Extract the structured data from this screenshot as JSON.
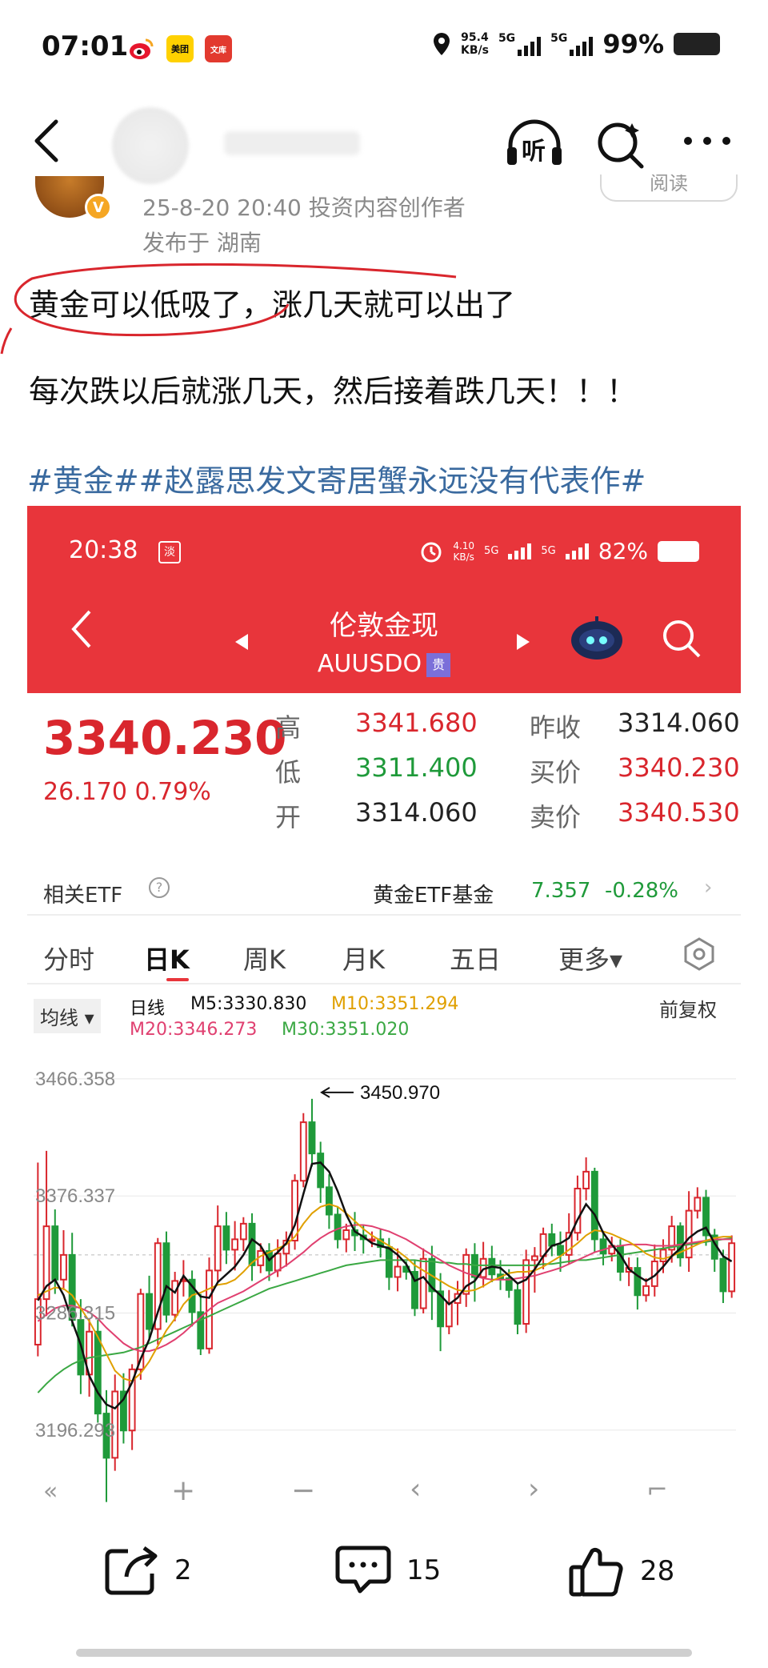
{
  "status_bar": {
    "time": "07:01",
    "app_icons": [
      "weibo",
      "美团",
      "文库"
    ],
    "net_speed_value": "95.4",
    "net_speed_unit": "KB/s",
    "net_1": "5G",
    "net_2": "5G",
    "battery": "99%"
  },
  "header": {
    "back": "back-arrow",
    "listen_label": "听",
    "search": "search-icon",
    "more": "more-icon"
  },
  "post": {
    "meta_line1": "25-8-20 20:40  投资内容创作者",
    "meta_line2": "发布于 湖南",
    "follow_label": "阅读",
    "line1": "黄金可以低吸了，涨几天就可以出了",
    "line2": "每次跌以后就涨几天，然后接着跌几天！！！",
    "hashtags": "#黄金##赵露思发文寄居蟹永远没有代表作#"
  },
  "embed": {
    "status": {
      "time": "20:38",
      "badge": "淡",
      "speed_value": "4.10",
      "speed_unit": "KB/s",
      "net_1": "5G",
      "net_2": "5G",
      "battery": "82%"
    },
    "title": "伦敦金现",
    "code": "AUUSDO",
    "code_tag": "贵",
    "price": "3340.230",
    "change": "26.170  0.79%",
    "quote_rows": [
      {
        "l1": "高",
        "v1": "3341.680",
        "l2": "昨收",
        "v2": "3314.060"
      },
      {
        "l1": "低",
        "v1": "3311.400",
        "l2": "买价",
        "v2": "3340.230"
      },
      {
        "l1": "开",
        "v1": "3314.060",
        "l2": "卖价",
        "v2": "3340.530"
      }
    ],
    "etf_label": "相关ETF",
    "etf_name": "黄金ETF基金",
    "etf_value": "7.357",
    "etf_change": "-0.28%",
    "tabs": [
      "分时",
      "日K",
      "周K",
      "月K",
      "五日",
      "更多▾"
    ],
    "ma_selector": "均线",
    "ma_daily": "日线",
    "ma5": "M5:3330.830",
    "ma10": "M10:3351.294",
    "ma20": "M20:3346.273",
    "ma30": "M30:3351.020",
    "adjust": "前复权",
    "colors": {
      "up": "#d9262d",
      "down": "#1f9a3a",
      "ma5": "#111111",
      "ma10": "#e0a000",
      "ma20": "#e04070",
      "ma30": "#3aa843"
    }
  },
  "chart_data": {
    "type": "candlestick",
    "title": "",
    "y_ticks": [
      "3466.358",
      "3376.337",
      "3286.315",
      "3196.293"
    ],
    "annotation": "3450.970",
    "ylim": [
      3150,
      3470
    ],
    "candles": [
      [
        3262,
        3297,
        3253,
        3402
      ],
      [
        3297,
        3353,
        3284,
        3411
      ],
      [
        3353,
        3312,
        3301,
        3366
      ],
      [
        3312,
        3331,
        3304,
        3350
      ],
      [
        3331,
        3281,
        3276,
        3348
      ],
      [
        3281,
        3239,
        3224,
        3297
      ],
      [
        3239,
        3272,
        3222,
        3282
      ],
      [
        3272,
        3209,
        3202,
        3281
      ],
      [
        3209,
        3175,
        3141,
        3227
      ],
      [
        3175,
        3226,
        3165,
        3239
      ],
      [
        3226,
        3196,
        3186,
        3240
      ],
      [
        3196,
        3243,
        3181,
        3247
      ],
      [
        3243,
        3301,
        3235,
        3305
      ],
      [
        3301,
        3274,
        3266,
        3315
      ],
      [
        3274,
        3340,
        3262,
        3344
      ],
      [
        3340,
        3285,
        3279,
        3349
      ],
      [
        3285,
        3311,
        3280,
        3318
      ],
      [
        3311,
        3312,
        3299,
        3327
      ],
      [
        3312,
        3287,
        3276,
        3319
      ],
      [
        3287,
        3259,
        3254,
        3301
      ],
      [
        3259,
        3319,
        3255,
        3329
      ],
      [
        3319,
        3353,
        3310,
        3369
      ],
      [
        3353,
        3335,
        3324,
        3364
      ],
      [
        3335,
        3343,
        3319,
        3357
      ],
      [
        3343,
        3355,
        3334,
        3360
      ],
      [
        3355,
        3323,
        3311,
        3363
      ],
      [
        3323,
        3334,
        3317,
        3340
      ],
      [
        3334,
        3319,
        3311,
        3340
      ],
      [
        3319,
        3332,
        3314,
        3343
      ],
      [
        3332,
        3342,
        3322,
        3349
      ],
      [
        3342,
        3388,
        3335,
        3393
      ],
      [
        3388,
        3433,
        3383,
        3440
      ],
      [
        3433,
        3409,
        3399,
        3451
      ],
      [
        3409,
        3383,
        3371,
        3418
      ],
      [
        3383,
        3362,
        3351,
        3393
      ],
      [
        3362,
        3343,
        3336,
        3368
      ],
      [
        3343,
        3350,
        3333,
        3355
      ],
      [
        3350,
        3346,
        3334,
        3364
      ],
      [
        3346,
        3343,
        3332,
        3354
      ],
      [
        3343,
        3343,
        3337,
        3349
      ],
      [
        3343,
        3337,
        3329,
        3351
      ],
      [
        3337,
        3314,
        3304,
        3344
      ],
      [
        3314,
        3322,
        3303,
        3336
      ],
      [
        3322,
        3318,
        3312,
        3326
      ],
      [
        3318,
        3290,
        3284,
        3327
      ],
      [
        3290,
        3328,
        3286,
        3336
      ],
      [
        3328,
        3303,
        3281,
        3338
      ],
      [
        3303,
        3276,
        3257,
        3317
      ],
      [
        3276,
        3294,
        3270,
        3304
      ],
      [
        3294,
        3301,
        3277,
        3311
      ],
      [
        3301,
        3331,
        3291,
        3336
      ],
      [
        3331,
        3314,
        3295,
        3340
      ],
      [
        3314,
        3328,
        3306,
        3341
      ],
      [
        3328,
        3316,
        3310,
        3338
      ],
      [
        3316,
        3313,
        3304,
        3327
      ],
      [
        3313,
        3304,
        3298,
        3320
      ],
      [
        3304,
        3278,
        3270,
        3310
      ],
      [
        3278,
        3327,
        3271,
        3335
      ],
      [
        3327,
        3330,
        3302,
        3337
      ],
      [
        3330,
        3347,
        3320,
        3352
      ],
      [
        3347,
        3338,
        3330,
        3355
      ],
      [
        3338,
        3331,
        3318,
        3349
      ],
      [
        3331,
        3348,
        3324,
        3363
      ],
      [
        3348,
        3382,
        3342,
        3392
      ],
      [
        3382,
        3395,
        3373,
        3406
      ],
      [
        3395,
        3343,
        3333,
        3398
      ],
      [
        3343,
        3332,
        3323,
        3349
      ],
      [
        3332,
        3338,
        3326,
        3345
      ],
      [
        3338,
        3318,
        3311,
        3343
      ],
      [
        3318,
        3321,
        3307,
        3329
      ],
      [
        3321,
        3300,
        3289,
        3329
      ],
      [
        3300,
        3307,
        3295,
        3313
      ],
      [
        3307,
        3326,
        3299,
        3339
      ],
      [
        3326,
        3335,
        3317,
        3343
      ],
      [
        3335,
        3353,
        3325,
        3361
      ],
      [
        3353,
        3329,
        3322,
        3356
      ],
      [
        3329,
        3365,
        3318,
        3380
      ],
      [
        3365,
        3375,
        3359,
        3383
      ],
      [
        3375,
        3346,
        3338,
        3381
      ],
      [
        3346,
        3328,
        3318,
        3351
      ],
      [
        3328,
        3303,
        3294,
        3335
      ],
      [
        3303,
        3340,
        3298,
        3346
      ]
    ],
    "ma5": [
      3296,
      3307,
      3312,
      3300,
      3280,
      3262,
      3238,
      3225,
      3216,
      3213,
      3220,
      3233,
      3251,
      3266,
      3287,
      3307,
      3302,
      3315,
      3307,
      3299,
      3298,
      3310,
      3316,
      3322,
      3331,
      3343,
      3338,
      3327,
      3333,
      3340,
      3354,
      3378,
      3401,
      3402,
      3395,
      3380,
      3362,
      3349,
      3345,
      3340,
      3338,
      3336,
      3331,
      3324,
      3311,
      3314,
      3306,
      3300,
      3293,
      3298,
      3307,
      3311,
      3320,
      3322,
      3321,
      3315,
      3309,
      3312,
      3320,
      3330,
      3338,
      3340,
      3344,
      3358,
      3370,
      3362,
      3348,
      3339,
      3331,
      3320,
      3315,
      3311,
      3315,
      3322,
      3330,
      3336,
      3344,
      3349,
      3352,
      3340,
      3330,
      3326
    ],
    "ma10": [
      3300,
      3303,
      3306,
      3305,
      3300,
      3290,
      3280,
      3268,
      3255,
      3242,
      3236,
      3234,
      3240,
      3249,
      3261,
      3273,
      3282,
      3293,
      3300,
      3302,
      3305,
      3308,
      3309,
      3312,
      3318,
      3325,
      3330,
      3333,
      3336,
      3339,
      3345,
      3355,
      3363,
      3368,
      3370,
      3368,
      3363,
      3357,
      3351,
      3346,
      3342,
      3338,
      3334,
      3329,
      3323,
      3319,
      3315,
      3311,
      3307,
      3304,
      3303,
      3304,
      3307,
      3311,
      3314,
      3317,
      3318,
      3318,
      3319,
      3322,
      3326,
      3330,
      3335,
      3340,
      3346,
      3350,
      3349,
      3347,
      3344,
      3341,
      3337,
      3332,
      3329,
      3328,
      3330,
      3333,
      3336,
      3339,
      3342,
      3344,
      3345,
      3345
    ],
    "ma20": [
      3280,
      3285,
      3290,
      3292,
      3292,
      3290,
      3287,
      3282,
      3275,
      3269,
      3263,
      3259,
      3257,
      3257,
      3259,
      3262,
      3266,
      3271,
      3277,
      3283,
      3289,
      3294,
      3297,
      3300,
      3303,
      3307,
      3311,
      3315,
      3319,
      3323,
      3328,
      3333,
      3339,
      3344,
      3348,
      3351,
      3353,
      3354,
      3354,
      3353,
      3351,
      3349,
      3346,
      3343,
      3339,
      3335,
      3331,
      3327,
      3323,
      3320,
      3317,
      3315,
      3313,
      3312,
      3312,
      3312,
      3313,
      3314,
      3315,
      3317,
      3319,
      3321,
      3324,
      3327,
      3330,
      3333,
      3335,
      3337,
      3338,
      3339,
      3339,
      3339,
      3338,
      3338,
      3338,
      3339,
      3340,
      3341,
      3342,
      3343,
      3343,
      3343
    ],
    "ma30": [
      3225,
      3232,
      3238,
      3243,
      3247,
      3250,
      3252,
      3253,
      3254,
      3255,
      3256,
      3258,
      3260,
      3263,
      3266,
      3269,
      3272,
      3275,
      3278,
      3281,
      3284,
      3287,
      3290,
      3293,
      3296,
      3299,
      3302,
      3305,
      3307,
      3309,
      3311,
      3313,
      3315,
      3317,
      3319,
      3321,
      3323,
      3324,
      3325,
      3326,
      3327,
      3327,
      3327,
      3327,
      3327,
      3326,
      3326,
      3325,
      3325,
      3324,
      3324,
      3323,
      3323,
      3323,
      3323,
      3323,
      3323,
      3323,
      3323,
      3324,
      3324,
      3325,
      3326,
      3327,
      3327,
      3328,
      3329,
      3330,
      3331,
      3332,
      3333,
      3334,
      3335,
      3336,
      3337,
      3338,
      3339,
      3340,
      3341,
      3342,
      3343,
      3344
    ]
  },
  "embed_controls": [
    "«",
    "+",
    "−",
    "‹",
    "›",
    "⌐"
  ],
  "toolbar": {
    "share_count": "2",
    "comment_count": "15",
    "like_count": "28"
  }
}
